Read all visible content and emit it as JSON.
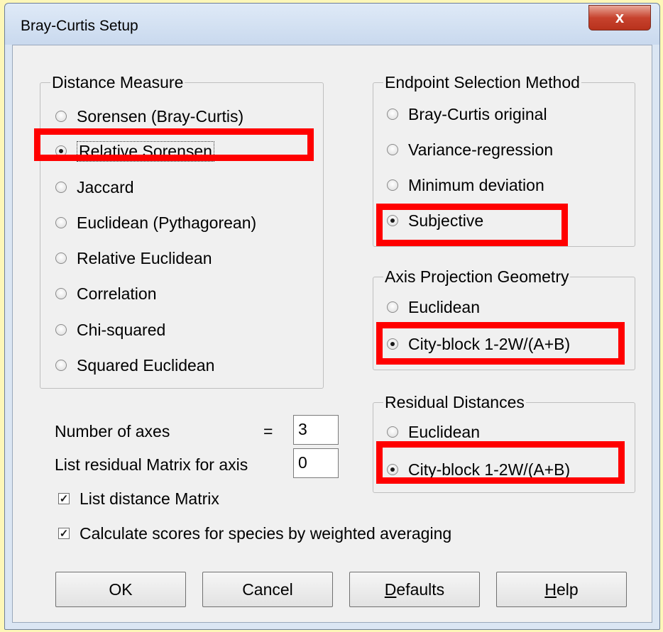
{
  "window": {
    "title": "Bray-Curtis Setup",
    "close_glyph": "x"
  },
  "distance_measure": {
    "label": "Distance Measure",
    "options": [
      "Sorensen (Bray-Curtis)",
      "Relative Sorensen",
      "Jaccard",
      "Euclidean (Pythagorean)",
      "Relative Euclidean",
      "Correlation",
      "Chi-squared",
      "Squared Euclidean"
    ],
    "selected": "Relative Sorensen"
  },
  "endpoint_selection": {
    "label": "Endpoint Selection Method",
    "options": [
      "Bray-Curtis original",
      "Variance-regression",
      "Minimum deviation",
      "Subjective"
    ],
    "selected": "Subjective"
  },
  "axis_projection": {
    "label": "Axis Projection Geometry",
    "options": [
      "Euclidean",
      "City-block 1-2W/(A+B)"
    ],
    "selected": "City-block 1-2W/(A+B)"
  },
  "residual_distances": {
    "label": "Residual Distances",
    "options": [
      "Euclidean",
      "City-block 1-2W/(A+B)"
    ],
    "selected": "City-block 1-2W/(A+B)"
  },
  "fields": {
    "number_of_axes_label": "Number of axes",
    "equals_sign": "=",
    "number_of_axes_value": "3",
    "list_residual_label": "List residual Matrix for axis",
    "list_residual_value": "0"
  },
  "checkboxes": {
    "list_distance_matrix": {
      "label": "List distance Matrix",
      "checked": true
    },
    "calculate_scores": {
      "label": "Calculate scores for species by weighted averaging",
      "checked": true
    }
  },
  "buttons": {
    "ok": "OK",
    "cancel": "Cancel",
    "defaults_mnemonic": "D",
    "defaults_rest": "efaults",
    "help_mnemonic": "H",
    "help_rest": "elp"
  },
  "colors": {
    "highlight": "#ff0000",
    "background": "#fdf7b8"
  }
}
